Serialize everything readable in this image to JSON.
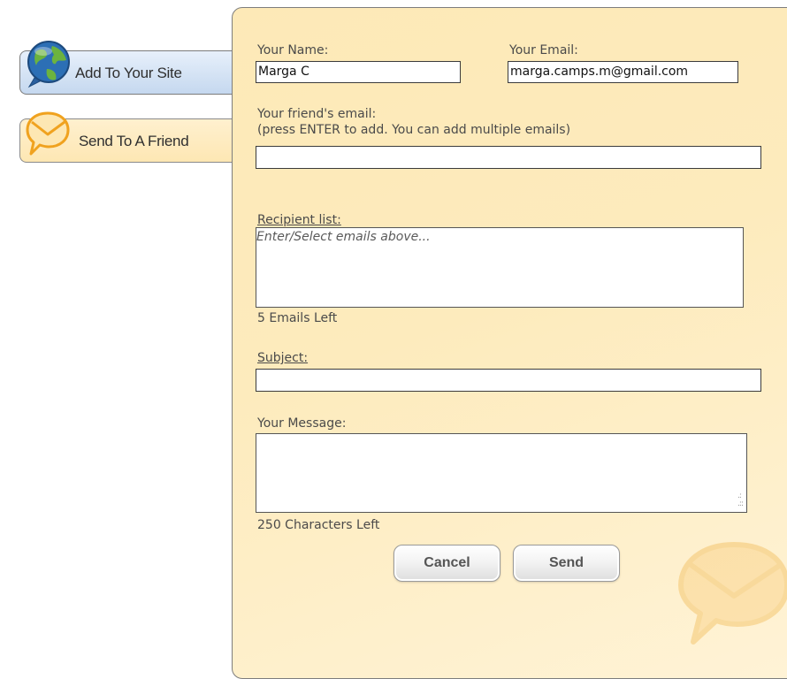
{
  "tabs": {
    "add_site": {
      "label": "Add To Your Site",
      "icon": "globe-icon"
    },
    "send_friend": {
      "label": "Send To A Friend",
      "icon": "speech-bubble-envelope-icon"
    }
  },
  "form": {
    "your_name": {
      "label": "Your Name:",
      "value": "Marga C"
    },
    "your_email": {
      "label": "Your Email:",
      "value": "marga.camps.m@gmail.com"
    },
    "friend_email": {
      "label": "Your friend's email:",
      "hint": "(press ENTER to add. You can add multiple emails)",
      "value": ""
    },
    "recipient_list": {
      "label": "Recipient list:",
      "placeholder": "Enter/Select emails above..."
    },
    "emails_left": "5  Emails Left",
    "subject": {
      "label": "Subject:",
      "value": ""
    },
    "message": {
      "label": "Your Message:",
      "value": ""
    },
    "characters_left": "250 Characters Left"
  },
  "buttons": {
    "cancel": "Cancel",
    "send": "Send"
  },
  "colors": {
    "panel_background": "#fde9b7",
    "add_tab_background": "#c5d8ef",
    "send_tab_background": "#fde7b3",
    "globe_blue": "#2c6fb5",
    "globe_green": "#6cb33f",
    "bubble_orange": "#f0a21f"
  }
}
